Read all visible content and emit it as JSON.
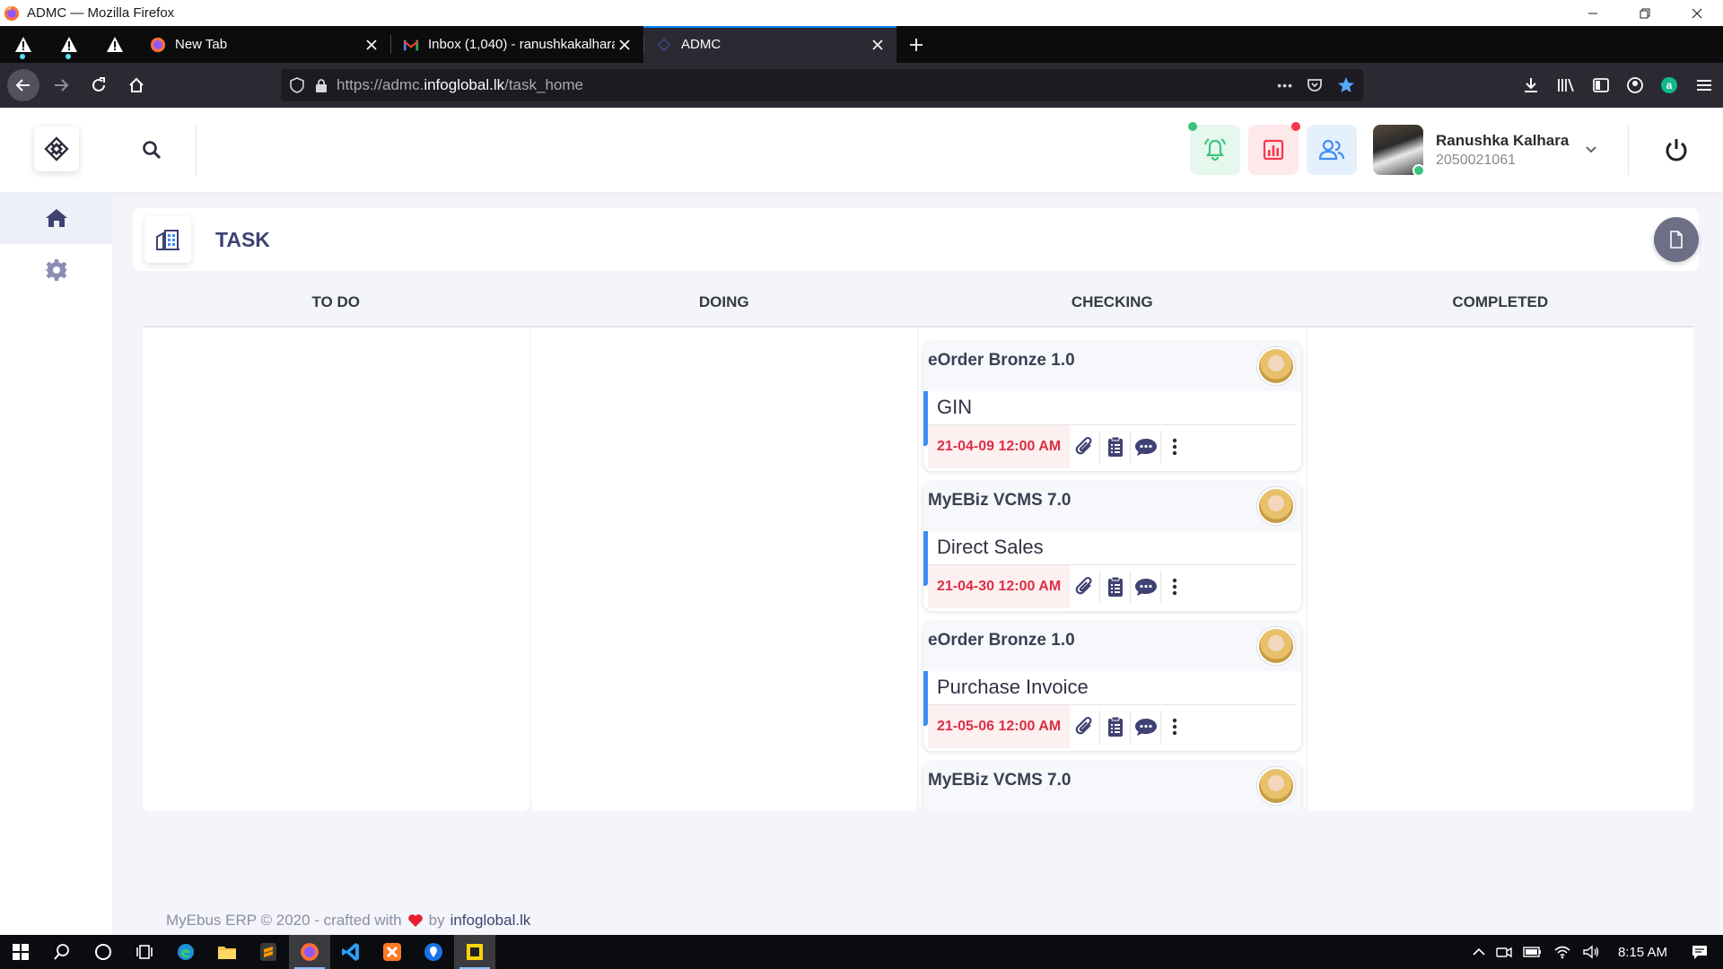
{
  "window": {
    "title": "ADMC — Mozilla Firefox"
  },
  "tabs": [
    {
      "label": "New Tab",
      "icon": "firefox-icon"
    },
    {
      "label": "Inbox (1,040) - ranushkakalhara",
      "icon": "gmail-icon"
    },
    {
      "label": "ADMC",
      "icon": "admc-icon",
      "active": true
    }
  ],
  "browser": {
    "url_prefix": "https://admc.",
    "url_domain": "infoglobal.lk",
    "url_path": "/task_home",
    "menu_dots": "•••"
  },
  "header": {
    "user_name": "Ranushka Kalhara",
    "user_id": "2050021061",
    "icons": {
      "notifications": "bell-icon",
      "reports": "chart-icon",
      "users": "users-icon"
    },
    "colors": {
      "green": "#3ac47d",
      "red": "#f7364f",
      "blue": "#3f8ef5"
    }
  },
  "sidebar": {
    "items": [
      {
        "icon": "home-icon",
        "active": true
      },
      {
        "icon": "settings-icon",
        "active": false
      }
    ]
  },
  "page": {
    "title": "TASK"
  },
  "board": {
    "columns": [
      {
        "title": "TO DO",
        "cards": []
      },
      {
        "title": "DOING",
        "cards": []
      },
      {
        "title": "CHECKING",
        "cards": [
          {
            "project": "eOrder Bronze 1.0",
            "name": "GIN",
            "date": "21-04-09 12:00 AM"
          },
          {
            "project": "MyEBiz VCMS 7.0",
            "name": "Direct Sales",
            "date": "21-04-30 12:00 AM"
          },
          {
            "project": "eOrder Bronze 1.0",
            "name": "Purchase Invoice",
            "date": "21-05-06 12:00 AM"
          },
          {
            "project": "MyEBiz VCMS 7.0",
            "name": "",
            "date": ""
          }
        ]
      },
      {
        "title": "COMPLETED",
        "cards": []
      }
    ]
  },
  "footer": {
    "text": "MyEbus ERP © 2020 - crafted with",
    "by": "by",
    "brand": "infoglobal.lk"
  },
  "taskbar": {
    "time": "8:15 AM"
  }
}
